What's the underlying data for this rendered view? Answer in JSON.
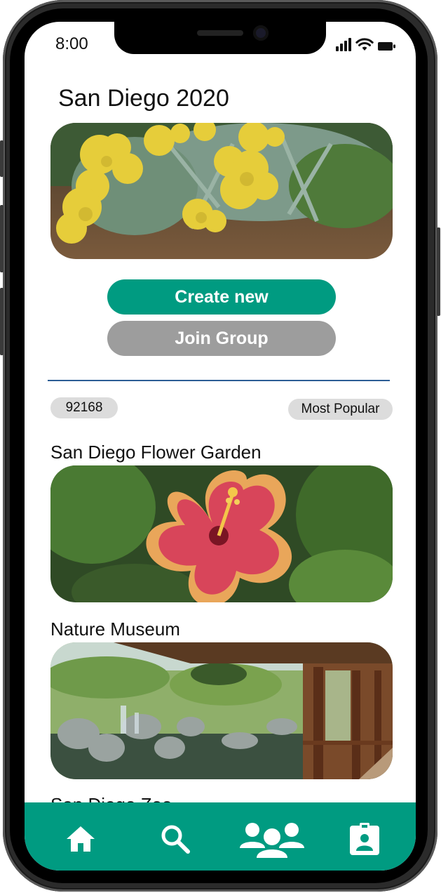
{
  "status_bar": {
    "time": "8:00"
  },
  "page": {
    "title": "San Diego 2020"
  },
  "actions": {
    "create_label": "Create new",
    "join_label": "Join Group"
  },
  "filters": {
    "zip": "92168",
    "sort": "Most Popular"
  },
  "places": [
    {
      "title": "San Diego Flower Garden"
    },
    {
      "title": "Nature Museum"
    },
    {
      "title": "San Diego Zoo"
    }
  ],
  "nav": {
    "items": [
      {
        "icon": "home-icon"
      },
      {
        "icon": "search-icon"
      },
      {
        "icon": "group-icon"
      },
      {
        "icon": "profile-badge-icon"
      }
    ]
  },
  "colors": {
    "accent": "#009b81",
    "secondary_button": "#9d9d9d",
    "divider": "#2c5d95",
    "chip": "#dcdcdc"
  }
}
